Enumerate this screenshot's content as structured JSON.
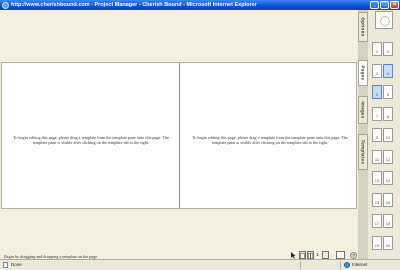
{
  "window": {
    "title": "http://www.cherishbound.com - Project Manager - Cherish Bound - Microsoft Internet Explorer",
    "min_label": "_",
    "max_label": "□",
    "close_label": "×"
  },
  "pages": {
    "left_message": "To begin editing this page, please drag a template from the template pane onto this page. The template pane is visible after clicking on the template tab to the right.",
    "right_message": "To begin editing this page, please drag a template from the template pane onto this page. The template pane is visible after clicking on the template tab to the right."
  },
  "status_message": "Begin by dragging and dropping a template on the page.",
  "toolbar": {
    "page_number": "1",
    "help_label": "?"
  },
  "side_tabs": {
    "options": "Options",
    "pages": "Pages",
    "images": "Images",
    "templates": "Templates"
  },
  "thumbnails": [
    "1",
    "2",
    "3",
    "4",
    "5",
    "6",
    "7",
    "8",
    "9",
    "10",
    "11",
    "12",
    "13",
    "14",
    "15",
    "16",
    "17",
    "18",
    "19",
    "20"
  ],
  "selected_pages": [
    "4",
    "5"
  ],
  "ie_status": {
    "done": "Done",
    "zone": "Internet"
  },
  "colors": {
    "titlebar": "#0a50d8",
    "canvas_bg": "#f5f0dd",
    "selected_thumb": "#c7dcf5"
  }
}
